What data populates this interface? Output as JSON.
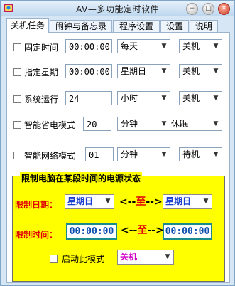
{
  "window": {
    "title": "AV—多功能定时软件",
    "min_glyph": "−",
    "max_glyph": "□",
    "close_glyph": "✕"
  },
  "tabs": [
    {
      "label": "关机任务",
      "active": true
    },
    {
      "label": "闹钟与备忘录",
      "active": false
    },
    {
      "label": "程序设置",
      "active": false
    },
    {
      "label": "设置",
      "active": false
    },
    {
      "label": "说明",
      "active": false
    }
  ],
  "tasks": [
    {
      "label": "固定时间",
      "checked": false,
      "value": "00:00:00",
      "unit": "每天",
      "action": "关机"
    },
    {
      "label": "指定星期",
      "checked": false,
      "value": "00:00:00",
      "unit": "星期日",
      "action": "关机"
    },
    {
      "label": "系统运行",
      "checked": false,
      "value": "24",
      "unit": "小时",
      "action": "关机"
    },
    {
      "label": "智能省电模式",
      "checked": false,
      "value": "20",
      "unit": "分钟",
      "action": "休眠"
    },
    {
      "label": "智能网络模式",
      "checked": false,
      "value": "01",
      "unit": "分钟",
      "action": "待机"
    }
  ],
  "restrict": {
    "title": "限制电脑在某段时间的电源状态",
    "date_label": "限制日期：",
    "time_label": "限制时间：",
    "date_from": "星期日",
    "date_to": "星期日",
    "time_from": "00:00:00",
    "time_to": "00:00:00",
    "sep_left": "<--",
    "sep_mid": "至",
    "sep_right": "-->",
    "enable_label": "启动此模式",
    "enable_checked": false,
    "mode": "关机"
  },
  "colors": {
    "highlight": "#ffff00",
    "label_red": "#e00000",
    "value_blue": "#1a3fd0",
    "mode_magenta": "#d000c8"
  }
}
